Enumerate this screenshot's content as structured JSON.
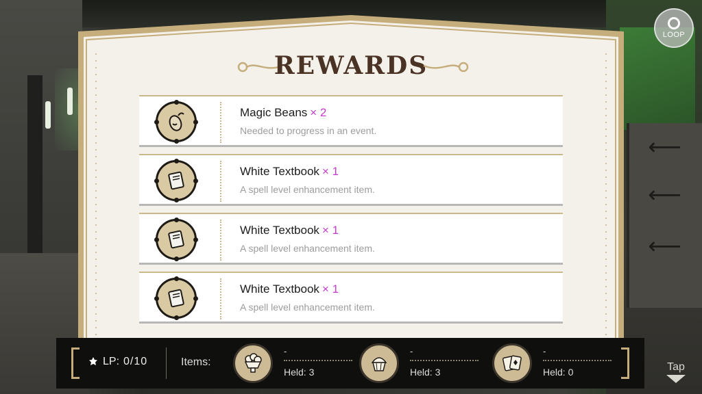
{
  "top_right": {
    "loop_label": "LOOP"
  },
  "rewards_panel": {
    "title": "REWARDS",
    "items": [
      {
        "name": "Magic Beans",
        "qty": "× 2",
        "description": "Needed to progress in an event.",
        "icon": "magic-beans-icon"
      },
      {
        "name": "White Textbook",
        "qty": "× 1",
        "description": "A spell level enhancement item.",
        "icon": "white-textbook-icon"
      },
      {
        "name": "White Textbook",
        "qty": "× 1",
        "description": "A spell level enhancement item.",
        "icon": "white-textbook-icon"
      },
      {
        "name": "White Textbook",
        "qty": "× 1",
        "description": "A spell level enhancement item.",
        "icon": "white-textbook-icon"
      }
    ]
  },
  "bottom_bar": {
    "lp_label": "LP:",
    "lp_value": "0/10",
    "items_label": "Items:",
    "items": [
      {
        "icon": "popcorn-bowl-icon",
        "name": "-",
        "held": "Held: 3"
      },
      {
        "icon": "cupcake-icon",
        "name": "-",
        "held": "Held: 3"
      },
      {
        "icon": "playing-cards-icon",
        "name": "-",
        "held": "Held: 0"
      }
    ],
    "tap_label": "Tap"
  },
  "colors": {
    "title": "#4a3224",
    "qty_accent": "#c33bc8",
    "panel_bg": "#f3f1ea",
    "panel_border": "#c6ad7c",
    "bar_bg": "#0f0f0e"
  }
}
